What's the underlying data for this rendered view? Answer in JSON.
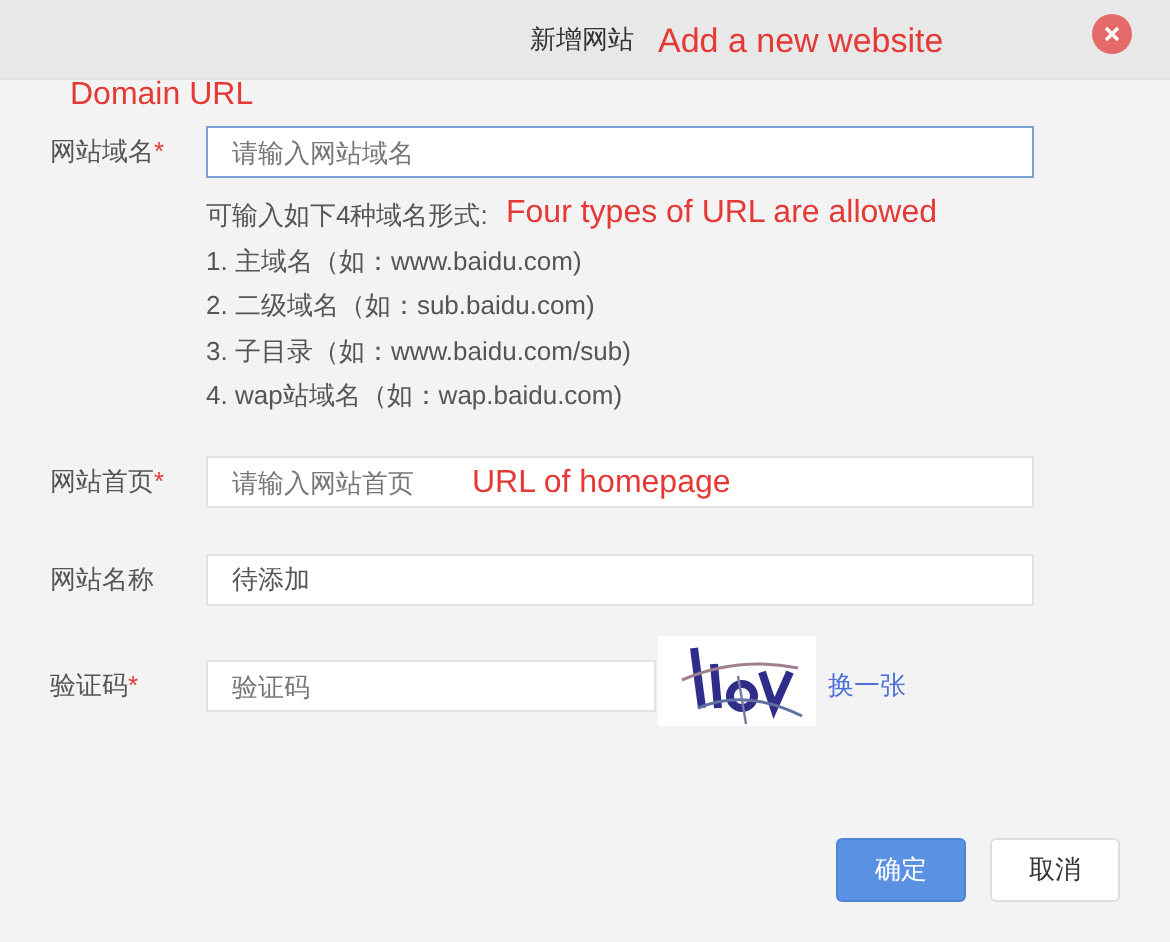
{
  "dialog": {
    "title": "新增网站"
  },
  "fields": [
    {
      "label": "网站域名",
      "required_mark": "*",
      "placeholder": "请输入网站域名",
      "focused": true,
      "kind": "text"
    },
    {
      "label": "网站首页",
      "required_mark": "*",
      "placeholder": "请输入网站首页",
      "focused": false,
      "kind": "text"
    },
    {
      "label": "网站名称",
      "value": "待添加",
      "focused": false,
      "kind": "text"
    },
    {
      "label": "验证码",
      "required_mark": "*",
      "placeholder": "验证码",
      "focused": false,
      "kind": "captcha",
      "refresh_link": "换一张"
    }
  ],
  "hint": {
    "intro": "可输入如下4种域名形式:",
    "items": [
      "1. 主域名（如：www.baidu.com)",
      "2. 二级域名（如：sub.baidu.com)",
      "3. 子目录（如：www.baidu.com/sub)",
      "4. wap站域名（如：wap.baidu.com)"
    ]
  },
  "buttons": [
    {
      "label": "确定",
      "kind": "primary"
    },
    {
      "label": "取消",
      "kind": "secondary"
    }
  ],
  "annotations": [
    "Add a new website",
    "Domain URL",
    "Four types of URL are allowed",
    "URL of homepage"
  ]
}
